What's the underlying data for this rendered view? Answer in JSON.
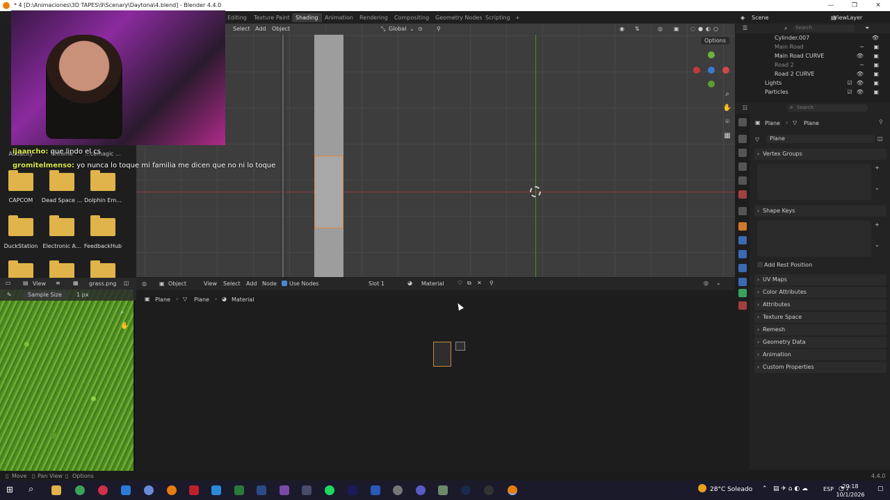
{
  "window": {
    "title": "* 4 [D:\\Animaciones\\3D TAPES\\9\\Scenary\\Daytona\\4.blend] - Blender 4.4.0"
  },
  "workspaces": [
    "Editing",
    "Texture Paint",
    "Shading",
    "Animation",
    "Rendering",
    "Compositing",
    "Geometry Nodes",
    "Scripting"
  ],
  "active_workspace": "Shading",
  "header_right": {
    "scene": "Scene",
    "view_layer": "ViewLayer"
  },
  "viewport": {
    "menu": [
      "Select",
      "Add",
      "Object"
    ],
    "orientation": "Global",
    "options_label": "Options"
  },
  "chat": [
    {
      "user": "ijaancho:",
      "message": "que lindo el cs"
    },
    {
      "user": "gromitelmenso:",
      "message": "yo nunca lo toque mi familia me dicen que no ni lo toque"
    }
  ],
  "desktop": {
    "behind_chat": [
      "Audacity",
      "Chrome",
      "...cemagic ..."
    ],
    "folders": [
      "CAPCOM",
      "Dead Space ...",
      "Dolphin Em...",
      "DuckStation",
      "Electronic A...",
      "FeedbackHub"
    ]
  },
  "image_editor": {
    "view_label": "View",
    "image_name": "grass.png",
    "sample_size_label": "Sample Size",
    "sample_size_value": "1 px"
  },
  "node_editor": {
    "mode": "Object",
    "menu": [
      "View",
      "Select",
      "Add",
      "Node"
    ],
    "use_nodes_label": "Use Nodes",
    "slot": "Slot 1",
    "material": "Material",
    "breadcrumb": [
      "Plane",
      "Plane",
      "Material"
    ]
  },
  "outliner": {
    "search_placeholder": "Search",
    "rows": [
      {
        "label": "Cylinder.007",
        "dim": false
      },
      {
        "label": "Main Road",
        "dim": true
      },
      {
        "label": "Main Road CURVE",
        "dim": false
      },
      {
        "label": "Road 2",
        "dim": true
      },
      {
        "label": "Road 2 CURVE",
        "dim": false
      },
      {
        "label": "Lights",
        "dim": false
      },
      {
        "label": "Particles",
        "dim": false
      }
    ]
  },
  "properties": {
    "search_placeholder": "Search",
    "breadcrumb": [
      "Plane",
      "Plane"
    ],
    "data_name": "Plane",
    "sections": [
      "Vertex Groups",
      "Shape Keys",
      "UV Maps",
      "Color Attributes",
      "Attributes",
      "Texture Space",
      "Remesh",
      "Geometry Data",
      "Animation",
      "Custom Properties"
    ],
    "add_rest_position": "Add Rest Position"
  },
  "statusbar": {
    "items": [
      "Move",
      "Pan View",
      "Options"
    ],
    "version": "4.4.0"
  },
  "taskbar": {
    "weather": "28°C  Soleado",
    "language": "ESP",
    "time": "20:18",
    "date": "10/1/2026"
  },
  "colors": {
    "accent": "#e87d0d",
    "selection_outline": "#e0883a",
    "x_axis": "#8a3a3a",
    "y_axis": "#4f8a2c",
    "chat_user": "#d8e84a"
  }
}
